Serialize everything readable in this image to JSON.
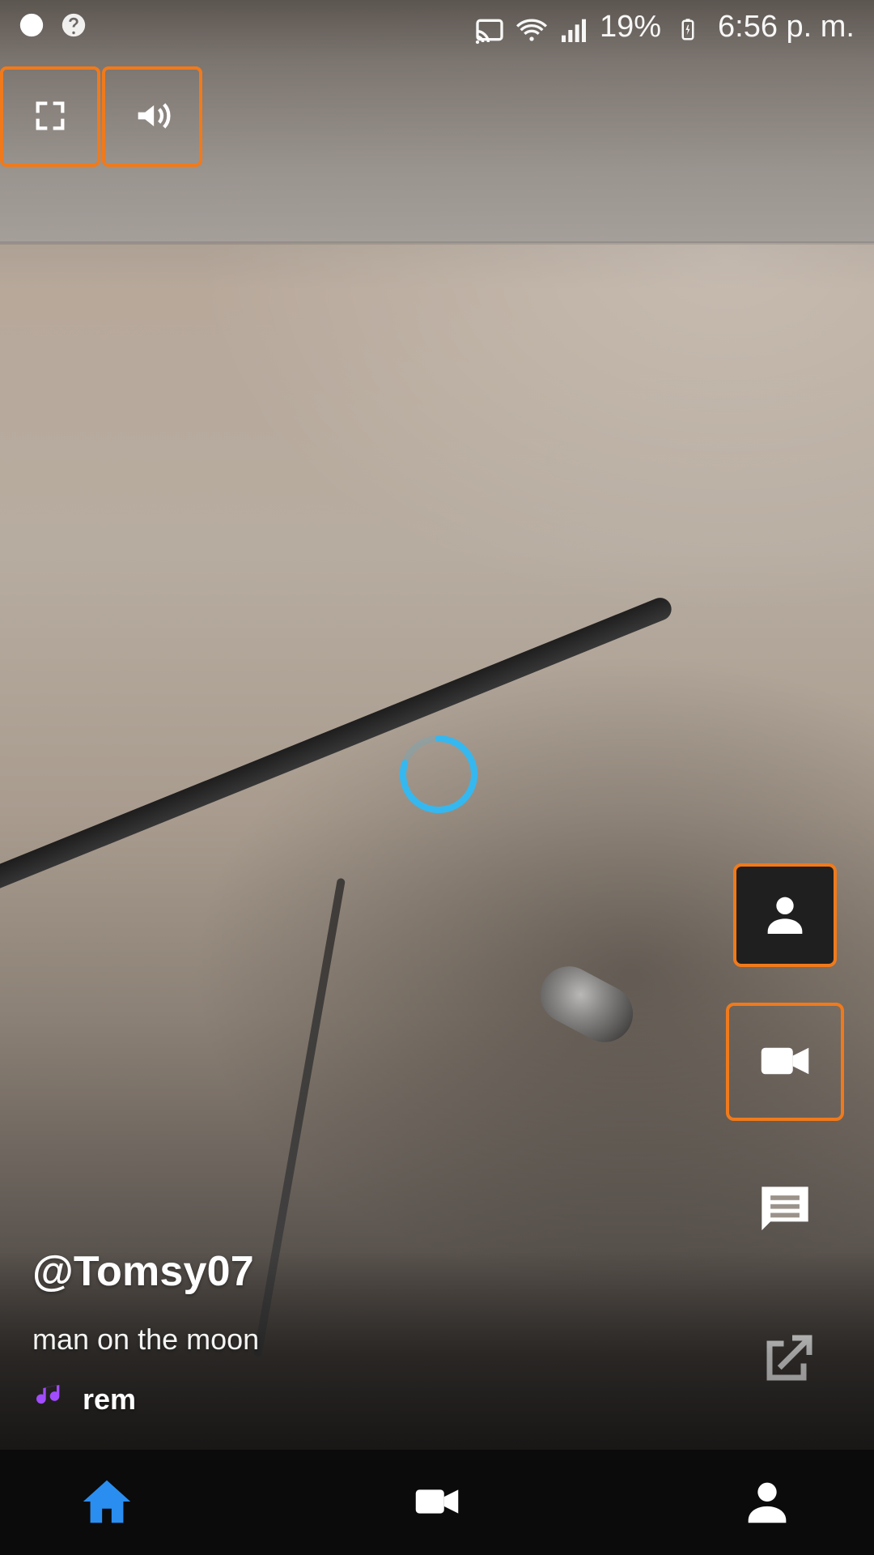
{
  "status_bar": {
    "battery_percent_text": "19%",
    "time_text": "6:56 p. m."
  },
  "colors": {
    "highlight_orange": "#f07a1b",
    "spinner_blue": "#35b8f0",
    "home_blue": "#2a8ef0",
    "music_purple": "#a24cff"
  },
  "content": {
    "username": "@Tomsy07",
    "caption": "man on the moon",
    "music": {
      "icon": "music-note-icon",
      "text": "rem"
    }
  },
  "controls": {
    "fullscreen_icon": "fullscreen-icon",
    "volume_icon": "volume-icon",
    "profile_icon": "person-icon",
    "video_icon": "video-camera-icon",
    "comment_icon": "comment-icon",
    "share_icon": "share-external-icon"
  },
  "bottom_nav": {
    "home_icon": "home-icon",
    "video_icon": "video-camera-icon",
    "profile_icon": "person-icon"
  }
}
